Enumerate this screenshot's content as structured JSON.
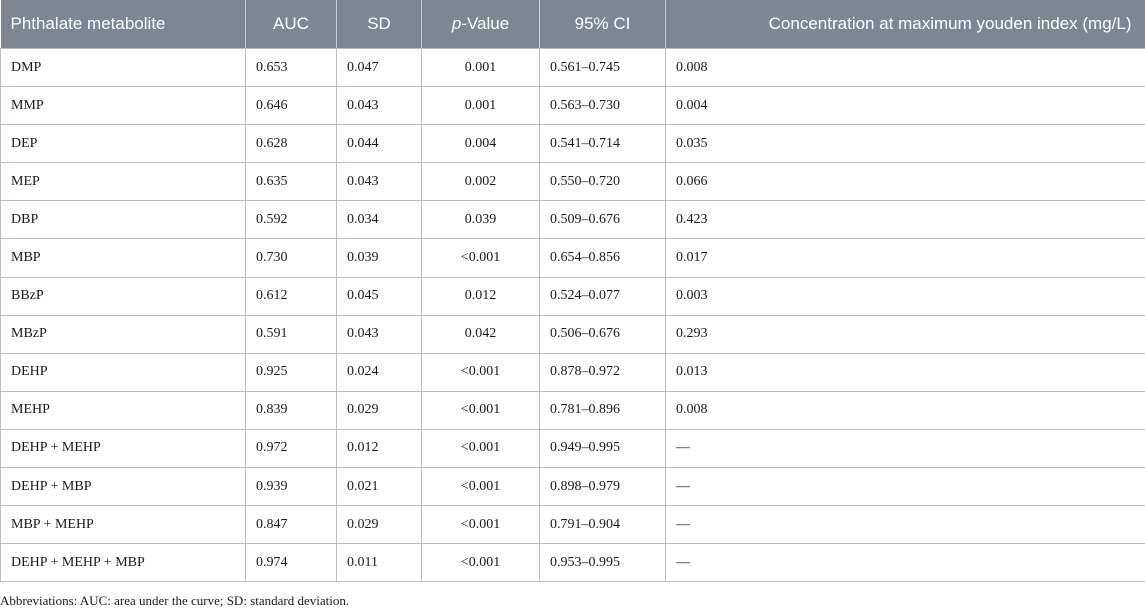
{
  "header": {
    "metabolite": "Phthalate metabolite",
    "auc": "AUC",
    "sd": "SD",
    "p_value_prefix": "p",
    "p_value_suffix": "-Value",
    "ci": "95% CI",
    "concentration": "Concentration at maximum youden index (mg/L)"
  },
  "rows": [
    {
      "metabolite": "DMP",
      "auc": "0.653",
      "sd": "0.047",
      "p": "0.001",
      "ci": "0.561–0.745",
      "conc": "0.008"
    },
    {
      "metabolite": "MMP",
      "auc": "0.646",
      "sd": "0.043",
      "p": "0.001",
      "ci": "0.563–0.730",
      "conc": "0.004"
    },
    {
      "metabolite": "DEP",
      "auc": "0.628",
      "sd": "0.044",
      "p": "0.004",
      "ci": "0.541–0.714",
      "conc": "0.035"
    },
    {
      "metabolite": "MEP",
      "auc": "0.635",
      "sd": "0.043",
      "p": "0.002",
      "ci": "0.550–0.720",
      "conc": "0.066"
    },
    {
      "metabolite": "DBP",
      "auc": "0.592",
      "sd": "0.034",
      "p": "0.039",
      "ci": "0.509–0.676",
      "conc": "0.423"
    },
    {
      "metabolite": "MBP",
      "auc": "0.730",
      "sd": "0.039",
      "p": "<0.001",
      "ci": "0.654–0.856",
      "conc": "0.017"
    },
    {
      "metabolite": "BBzP",
      "auc": "0.612",
      "sd": "0.045",
      "p": "0.012",
      "ci": "0.524–0.077",
      "conc": "0.003"
    },
    {
      "metabolite": "MBzP",
      "auc": "0.591",
      "sd": "0.043",
      "p": "0.042",
      "ci": "0.506–0.676",
      "conc": "0.293"
    },
    {
      "metabolite": "DEHP",
      "auc": "0.925",
      "sd": "0.024",
      "p": "<0.001",
      "ci": "0.878–0.972",
      "conc": "0.013"
    },
    {
      "metabolite": "MEHP",
      "auc": "0.839",
      "sd": "0.029",
      "p": "<0.001",
      "ci": "0.781–0.896",
      "conc": "0.008"
    },
    {
      "metabolite": "DEHP + MEHP",
      "auc": "0.972",
      "sd": "0.012",
      "p": "<0.001",
      "ci": "0.949–0.995",
      "conc": "—"
    },
    {
      "metabolite": "DEHP + MBP",
      "auc": "0.939",
      "sd": "0.021",
      "p": "<0.001",
      "ci": "0.898–0.979",
      "conc": "—"
    },
    {
      "metabolite": "MBP + MEHP",
      "auc": "0.847",
      "sd": "0.029",
      "p": "<0.001",
      "ci": "0.791–0.904",
      "conc": "—"
    },
    {
      "metabolite": "DEHP + MEHP + MBP",
      "auc": "0.974",
      "sd": "0.011",
      "p": "<0.001",
      "ci": "0.953–0.995",
      "conc": "—"
    }
  ],
  "footnote": "Abbreviations: AUC: area under the curve; SD: standard deviation.",
  "colors": {
    "header_bg": "#7d8791",
    "header_text": "#ffffff",
    "grid": "#b9bfc5"
  }
}
